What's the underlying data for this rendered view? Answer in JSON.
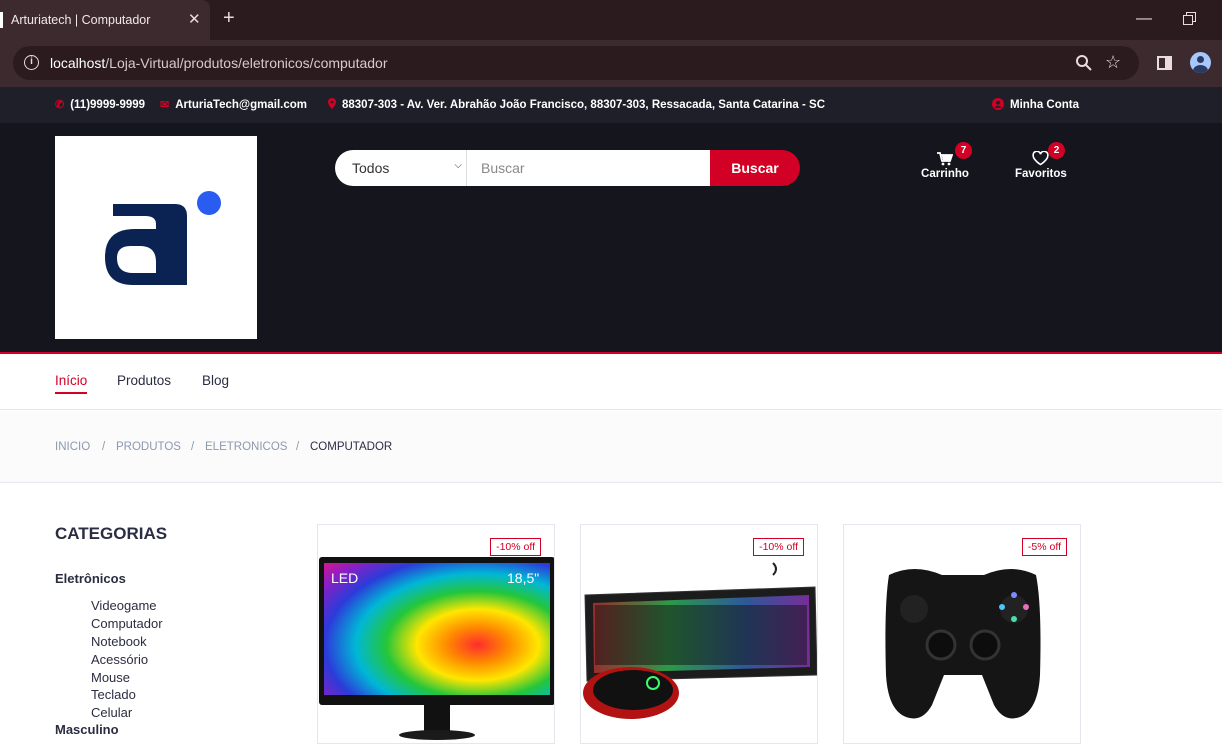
{
  "browser": {
    "tab_title": "Arturiatech | Computador",
    "tab_close": "✕",
    "new_tab": "+",
    "url_host": "localhost",
    "url_path": "/Loja-Virtual/produtos/eletronicos/computador"
  },
  "topbar": {
    "phone": "(11)9999-9999",
    "email": "ArturiaTech@gmail.com",
    "address": "88307-303 - Av. Ver. Abrahão João Francisco, 88307-303, Ressacada, Santa Catarina - SC",
    "account": "Minha Conta"
  },
  "search": {
    "category": "Todos",
    "placeholder": "Buscar",
    "button": "Buscar"
  },
  "header": {
    "cart_label": "Carrinho",
    "cart_count": "7",
    "fav_label": "Favoritos",
    "fav_count": "2"
  },
  "nav": [
    "Início",
    "Produtos",
    "Blog"
  ],
  "breadcrumb": [
    "INICIO",
    "PRODUTOS",
    "ELETRONICOS",
    "COMPUTADOR"
  ],
  "categories": {
    "title": "CATEGORIAS",
    "groups": [
      {
        "name": "Eletrônicos",
        "items": [
          "Videogame",
          "Computador",
          "Notebook",
          "Acessório",
          "Mouse",
          "Teclado",
          "Celular"
        ]
      },
      {
        "name": "Masculino"
      }
    ]
  },
  "products": [
    {
      "discount": "-10% off",
      "screen_text_left": "LED",
      "screen_text_right": "18,5\""
    },
    {
      "discount": "-10% off"
    },
    {
      "discount": "-5% off"
    }
  ],
  "colors": {
    "accent": "#d10024",
    "header_bg": "#15161d",
    "topbar_bg": "#1e1f29"
  }
}
